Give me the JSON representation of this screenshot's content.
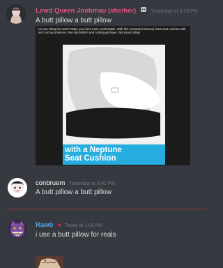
{
  "messages": [
    {
      "username": "Lewd Queen Joobmau (she/her)",
      "timestamp": "Yesterday at 3:16 PM",
      "text": "A butt pillow a butt pillow",
      "username_color": "#e05583",
      "embed": {
        "caption": "Are you sitting for work? Make your bum more comfortable. With this contoured memory foam seat cushion with zero coccyx pressure. Non slip bottom and cooling gel layer. Get yours today!",
        "banner": "with a Neptune\nSeat Cushion",
        "banner_color": "#27aee0"
      }
    },
    {
      "username": "conbruem",
      "timestamp": "Yesterday at 8:41 PM",
      "text": "A butt pillow a butt pillow",
      "username_color": "#ffffff"
    },
    {
      "username": "Rawb",
      "timestamp": "Today at 1:06 AM",
      "text": "i use a butt pillow for reals",
      "username_color": "#4fa7e6"
    }
  ],
  "icons": [
    "avatar-icon",
    "robot-badge-icon",
    "heart-badge-icon"
  ],
  "colors": {
    "background": "#36393f",
    "divider": "#8e3f44"
  }
}
